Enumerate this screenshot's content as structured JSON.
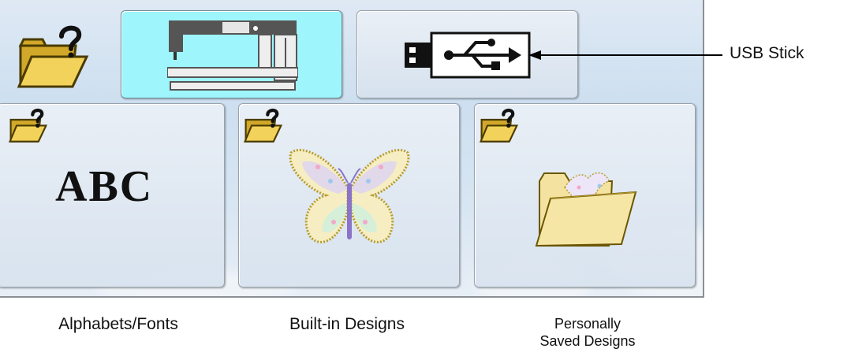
{
  "toolbar": {
    "folder_icon": "folder-question-icon",
    "tabs": [
      {
        "name": "sewing-machine",
        "icon": "sewing-machine-icon",
        "active": true
      },
      {
        "name": "usb",
        "icon": "usb-icon",
        "active": false
      }
    ]
  },
  "categories": [
    {
      "id": "alphabets",
      "sample_text": "ABC",
      "label": "Alphabets/Fonts"
    },
    {
      "id": "builtin",
      "label": "Built-in Designs"
    },
    {
      "id": "personal",
      "label_line1": "Personally",
      "label_line2": "Saved Designs"
    }
  ],
  "annotation": {
    "usb_label": "USB Stick"
  },
  "colors": {
    "active_tab": "#9ef5fb",
    "folder": "#e8c23a",
    "folder_outline": "#6b5600"
  }
}
